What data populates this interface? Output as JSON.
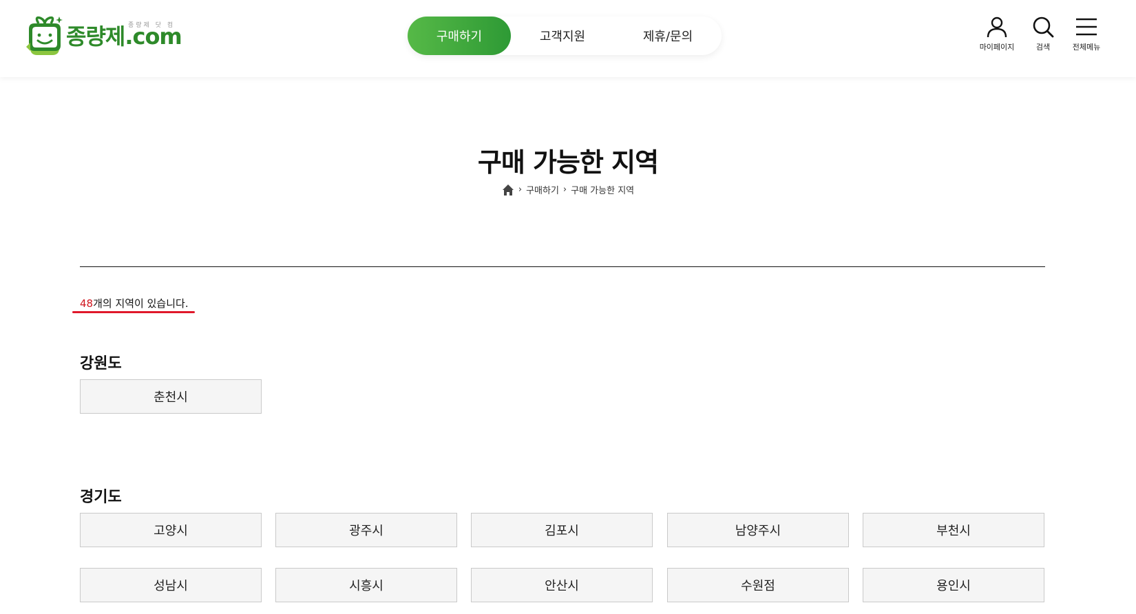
{
  "brand": {
    "logo_text": "종량제.com",
    "logo_sub": "종량제 닷 컴",
    "primary_color": "#3da93a",
    "highlight_color": "#d0161e"
  },
  "nav": {
    "items": [
      {
        "label": "구매하기",
        "active": true
      },
      {
        "label": "고객지원",
        "active": false
      },
      {
        "label": "제휴/문의",
        "active": false
      }
    ]
  },
  "utilities": {
    "mypage": {
      "label": "마이페이지",
      "icon": "user-icon"
    },
    "search": {
      "label": "검색",
      "icon": "search-icon"
    },
    "menu": {
      "label": "전체메뉴",
      "icon": "hamburger-icon"
    }
  },
  "page": {
    "title": "구매 가능한 지역",
    "breadcrumb": [
      "구매하기",
      "구매 가능한 지역"
    ],
    "count_number": "48",
    "count_suffix": "개의 지역이 있습니다."
  },
  "regions": [
    {
      "name": "강원도",
      "cities": [
        "춘천시"
      ]
    },
    {
      "name": "경기도",
      "cities": [
        "고양시",
        "광주시",
        "김포시",
        "남양주시",
        "부천시",
        "성남시",
        "시흥시",
        "안산시",
        "수원점",
        "용인시"
      ]
    }
  ]
}
